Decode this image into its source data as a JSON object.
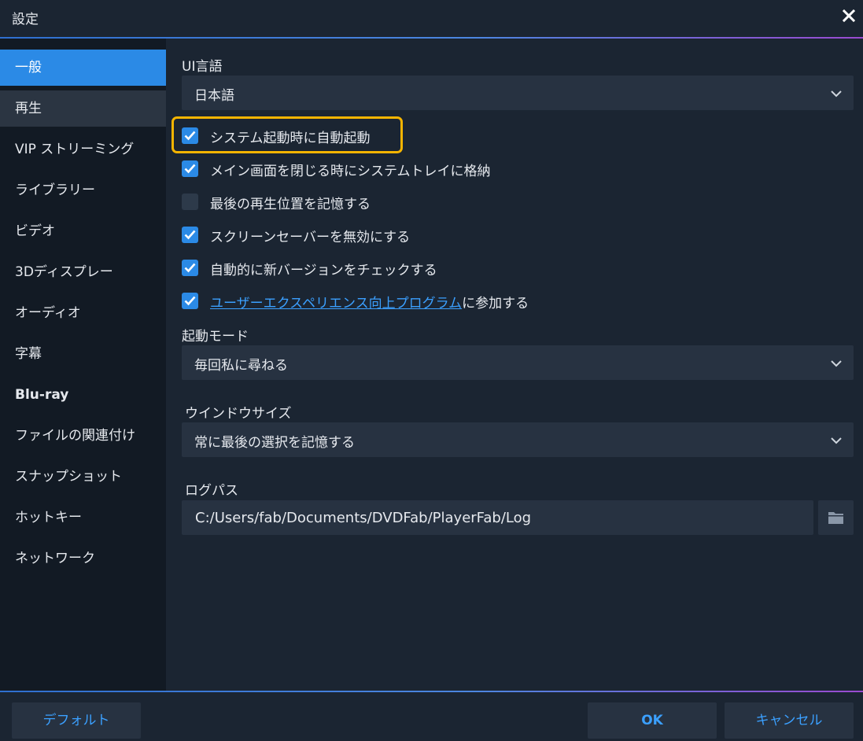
{
  "window": {
    "title": "設定"
  },
  "sidebar": {
    "items": [
      {
        "label": "一般"
      },
      {
        "label": "再生"
      },
      {
        "label": "VIP ストリーミング"
      },
      {
        "label": "ライブラリー"
      },
      {
        "label": "ビデオ"
      },
      {
        "label": "3Dディスプレー"
      },
      {
        "label": "オーディオ"
      },
      {
        "label": "字幕"
      },
      {
        "label": "Blu-ray"
      },
      {
        "label": "ファイルの関連付け"
      },
      {
        "label": "スナップショット"
      },
      {
        "label": "ホットキー"
      },
      {
        "label": "ネットワーク"
      }
    ]
  },
  "general": {
    "ui_language": {
      "label": "UI言語",
      "value": "日本語"
    },
    "checkboxes": [
      {
        "label": "システム起動時に自動起動",
        "checked": true
      },
      {
        "label": "メイン画面を閉じる時にシステムトレイに格納",
        "checked": true
      },
      {
        "label": "最後の再生位置を記憶する",
        "checked": false
      },
      {
        "label": "スクリーンセーバーを無効にする",
        "checked": true
      },
      {
        "label": "自動的に新バージョンをチェックする",
        "checked": true
      },
      {
        "link": "ユーザーエクスペリエンス向上プログラム",
        "suffix": "に参加する",
        "checked": true
      }
    ],
    "startup_mode": {
      "label": "起動モード",
      "value": "毎回私に尋ねる"
    },
    "window_size": {
      "label": "ウインドウサイズ",
      "value": "常に最後の選択を記憶する"
    },
    "log_path": {
      "label": "ログパス",
      "value": "C:/Users/fab/Documents/DVDFab/PlayerFab/Log"
    }
  },
  "footer": {
    "default_label": "デフォルト",
    "ok_label": "OK",
    "cancel_label": "キャンセル"
  },
  "colors": {
    "accent": "#2b8ae6",
    "highlight": "#f5b400",
    "link": "#3ba0ff"
  }
}
